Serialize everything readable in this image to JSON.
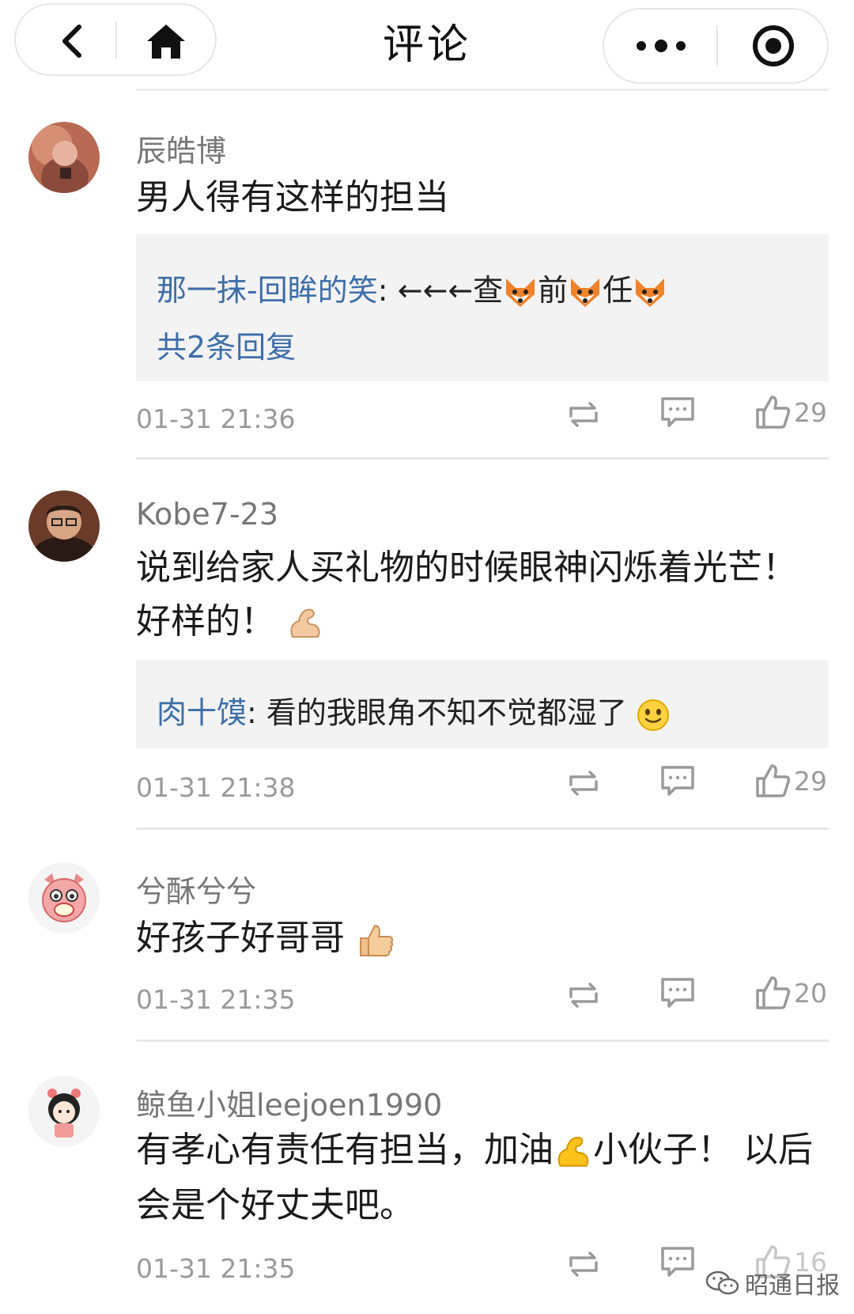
{
  "header": {
    "title": "评论"
  },
  "comments": [
    {
      "username": "辰皓博",
      "text": "男人得有这样的担当",
      "reply": {
        "user": "那一抹-回眸的笑",
        "text": ": ←←←查",
        "after1": "前",
        "after2": "任"
      },
      "reply_count": "共2条回复",
      "time": "01-31 21:36",
      "likes": "29"
    },
    {
      "username": "Kobe7-23",
      "text_line1": "说到给家人买礼物的时候眼神闪烁着光芒！",
      "text_line2": "好样的！",
      "reply": {
        "user": "肉十馍",
        "text": ": 看的我眼角不知不觉都湿了"
      },
      "time": "01-31 21:38",
      "likes": "29"
    },
    {
      "username": "兮酥兮兮",
      "text": "好孩子好哥哥",
      "time": "01-31 21:35",
      "likes": "20"
    },
    {
      "username": "鲸鱼小姐leejoen1990",
      "text_line1a": "有孝心有责任有担当，加油",
      "text_line1b": "小伙子！ 以后",
      "text_line2": "会是个好丈夫吧。",
      "time": "01-31 21:35",
      "likes": "16"
    }
  ],
  "watermark": "昭通日报",
  "icons": {
    "back": "chevron-left-icon",
    "home": "home-icon",
    "more": "more-dots-icon",
    "capsule": "record-circle-icon",
    "repost": "repost-icon",
    "comment": "comment-icon",
    "like": "thumbs-up-icon"
  },
  "colors": {
    "link": "#3d6ea8",
    "meta": "#9a9a9a",
    "reply_bg": "#f3f3f3"
  }
}
